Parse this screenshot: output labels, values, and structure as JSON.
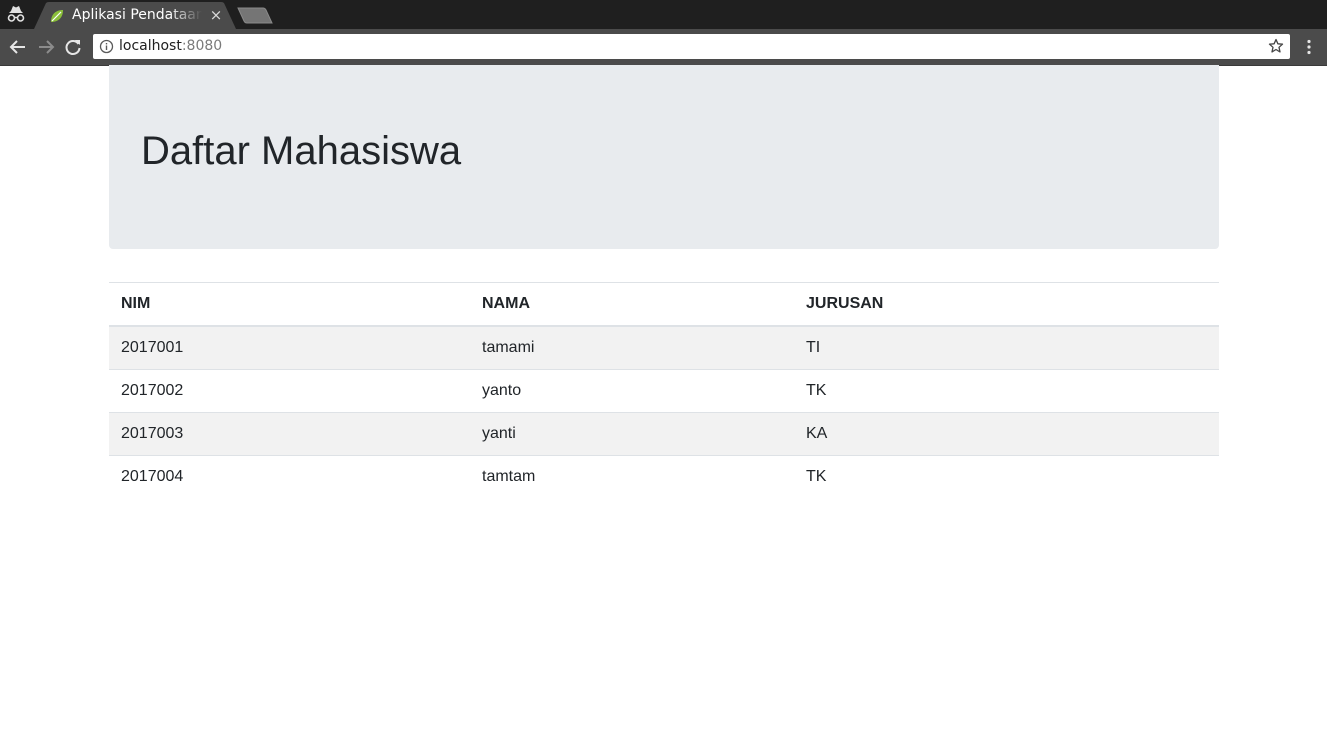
{
  "browser": {
    "tab_title": "Aplikasi Pendataan",
    "tab_close": "×",
    "url_host": "localhost",
    "url_port": ":8080"
  },
  "page": {
    "title": "Daftar Mahasiswa"
  },
  "table": {
    "headers": [
      "NIM",
      "NAMA",
      "JURUSAN"
    ],
    "rows": [
      [
        "2017001",
        "tamami",
        "TI"
      ],
      [
        "2017002",
        "yanto",
        "TK"
      ],
      [
        "2017003",
        "yanti",
        "KA"
      ],
      [
        "2017004",
        "tamtam",
        "TK"
      ]
    ]
  },
  "colors": {
    "tabbar": "#1f1f1f",
    "toolbar": "#4b4b4b",
    "jumbotron": "#e8ebee",
    "striped_row": "#f2f2f2",
    "favicon_leaf": "#8bbf3a"
  }
}
